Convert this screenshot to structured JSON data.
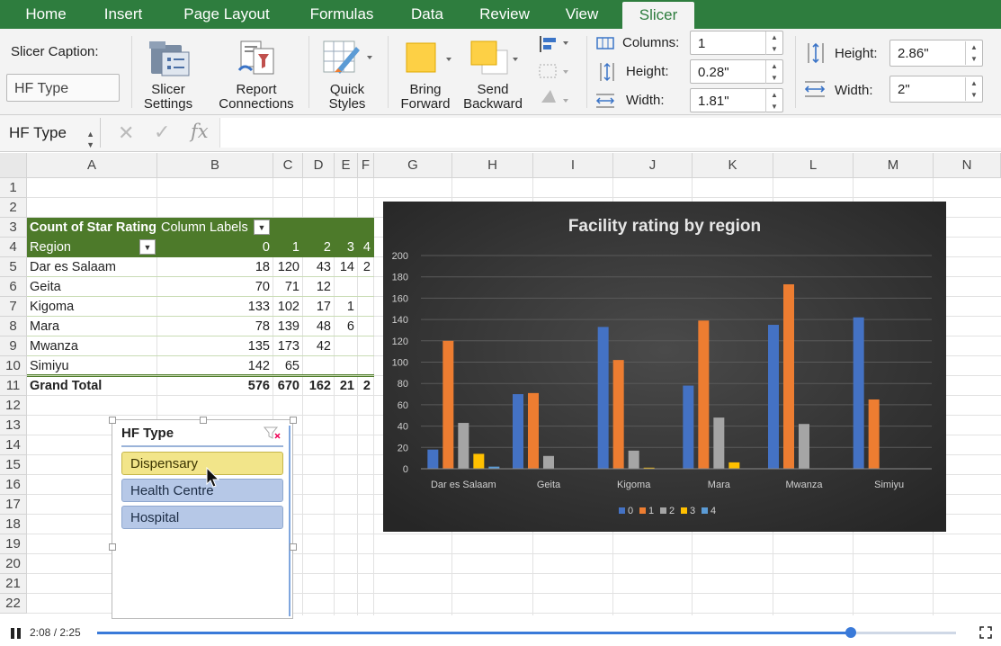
{
  "ribbon_tabs": [
    "Home",
    "Insert",
    "Page Layout",
    "Formulas",
    "Data",
    "Review",
    "View",
    "Slicer"
  ],
  "active_tab": "Slicer",
  "ribbon": {
    "slicer_caption_label": "Slicer Caption:",
    "slicer_caption_value": "HF Type",
    "slicer_settings": "Slicer Settings",
    "report_connections": "Report Connections",
    "quick_styles": "Quick Styles",
    "bring_forward": "Bring Forward",
    "send_backward": "Send Backward",
    "columns_label": "Columns:",
    "columns_value": "1",
    "btn_height_label": "Height:",
    "btn_height_value": "0.28\"",
    "btn_width_label": "Width:",
    "btn_width_value": "1.81\"",
    "height_label": "Height:",
    "height_value": "2.86\"",
    "width_label": "Width:",
    "width_value": "2\""
  },
  "formula_bar": {
    "name_box": "HF Type",
    "fx": "fx"
  },
  "columns": [
    "A",
    "B",
    "C",
    "D",
    "E",
    "F",
    "G",
    "H",
    "I",
    "J",
    "K",
    "L",
    "M",
    "N"
  ],
  "rows": [
    "1",
    "2",
    "3",
    "4",
    "5",
    "6",
    "7",
    "8",
    "9",
    "10",
    "11",
    "12",
    "13",
    "14",
    "15",
    "16",
    "17",
    "18",
    "19",
    "20",
    "21",
    "22"
  ],
  "pivot": {
    "header_a": "Count of Star Rating",
    "header_b": "Column Labels",
    "region_label": "Region",
    "col_labels": [
      "0",
      "1",
      "2",
      "3",
      "4"
    ],
    "rows": [
      {
        "region": "Dar es Salaam",
        "v": [
          "18",
          "120",
          "43",
          "14",
          "2"
        ]
      },
      {
        "region": "Geita",
        "v": [
          "70",
          "71",
          "12",
          "",
          ""
        ]
      },
      {
        "region": "Kigoma",
        "v": [
          "133",
          "102",
          "17",
          "1",
          ""
        ]
      },
      {
        "region": "Mara",
        "v": [
          "78",
          "139",
          "48",
          "6",
          ""
        ]
      },
      {
        "region": "Mwanza",
        "v": [
          "135",
          "173",
          "42",
          "",
          ""
        ]
      },
      {
        "region": "Simiyu",
        "v": [
          "142",
          "65",
          "",
          "",
          ""
        ]
      }
    ],
    "grand_total_label": "Grand Total",
    "grand_total": [
      "576",
      "670",
      "162",
      "21",
      "2"
    ]
  },
  "slicer": {
    "title": "HF Type",
    "items": [
      "Dispensary",
      "Health Centre",
      "Hospital"
    ],
    "selected": "Dispensary"
  },
  "chart_data": {
    "type": "bar",
    "title": "Facility rating by region",
    "categories": [
      "Dar es Salaam",
      "Geita",
      "Kigoma",
      "Mara",
      "Mwanza",
      "Simiyu"
    ],
    "series": [
      {
        "name": "0",
        "color": "#4472c4",
        "values": [
          18,
          70,
          133,
          78,
          135,
          142
        ]
      },
      {
        "name": "1",
        "color": "#ed7d31",
        "values": [
          120,
          71,
          102,
          139,
          173,
          65
        ]
      },
      {
        "name": "2",
        "color": "#a5a5a5",
        "values": [
          43,
          12,
          17,
          48,
          42,
          0
        ]
      },
      {
        "name": "3",
        "color": "#ffc000",
        "values": [
          14,
          0,
          1,
          6,
          0,
          0
        ]
      },
      {
        "name": "4",
        "color": "#5b9bd5",
        "values": [
          2,
          0,
          0,
          0,
          0,
          0
        ]
      }
    ],
    "yticks": [
      "0",
      "20",
      "40",
      "60",
      "80",
      "100",
      "120",
      "140",
      "160",
      "180",
      "200"
    ],
    "ylim": [
      0,
      200
    ],
    "legend_position": "bottom",
    "grid": true
  },
  "video": {
    "time": "2:08 / 2:25",
    "progress": 0.877
  }
}
